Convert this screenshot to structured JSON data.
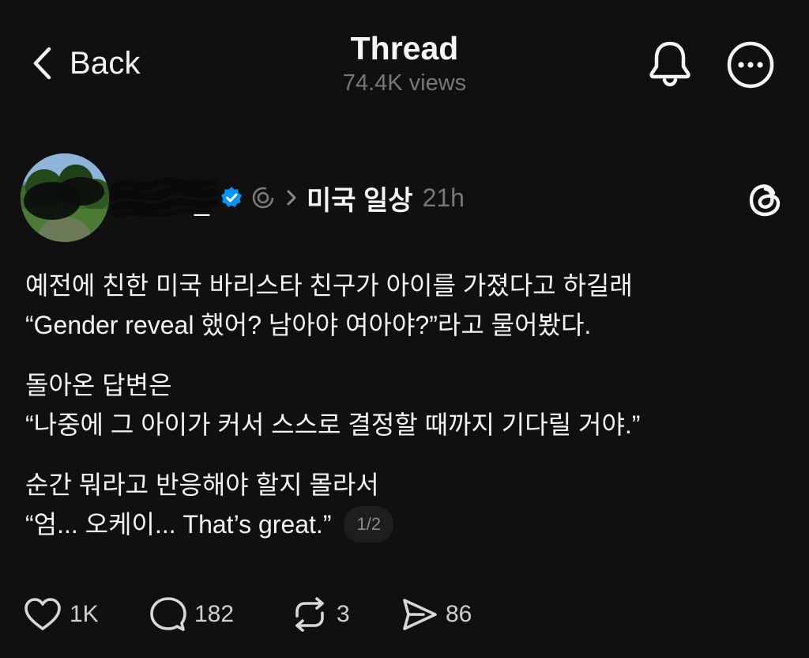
{
  "header": {
    "back_label": "Back",
    "title": "Thread",
    "views": "74.4K views"
  },
  "post": {
    "username_visible": "_",
    "topic": "미국 일상",
    "time": "21h",
    "verified_color": "#0095f6",
    "paragraphs": [
      {
        "lines": [
          "예전에 친한 미국 바리스타 친구가 아이를 가졌다고 하길래",
          "“Gender reveal 했어? 남아야 여아야?”라고 물어봤다."
        ]
      },
      {
        "lines": [
          "돌아온 답변은",
          "“나중에 그 아이가 커서 스스로 결정할 때까지 기다릴 거야.”"
        ]
      },
      {
        "lines": [
          "순간 뭐라고 반응해야 할지 몰라서",
          "“엄... 오케이... That’s great.”"
        ]
      }
    ],
    "page_indicator": "1/2"
  },
  "actions": {
    "like_count": "1K",
    "reply_count": "182",
    "repost_count": "3",
    "share_count": "86"
  },
  "icons": {
    "back": "chevron-left-icon",
    "bell": "bell-icon",
    "more": "more-horizontal-icon",
    "verified": "verified-badge-icon",
    "threads": "threads-logo-icon",
    "like": "heart-icon",
    "reply": "comment-icon",
    "repost": "repost-icon",
    "share": "send-icon"
  },
  "colors": {
    "background": "#101010",
    "text": "#f3f5f7",
    "muted": "#777777"
  }
}
